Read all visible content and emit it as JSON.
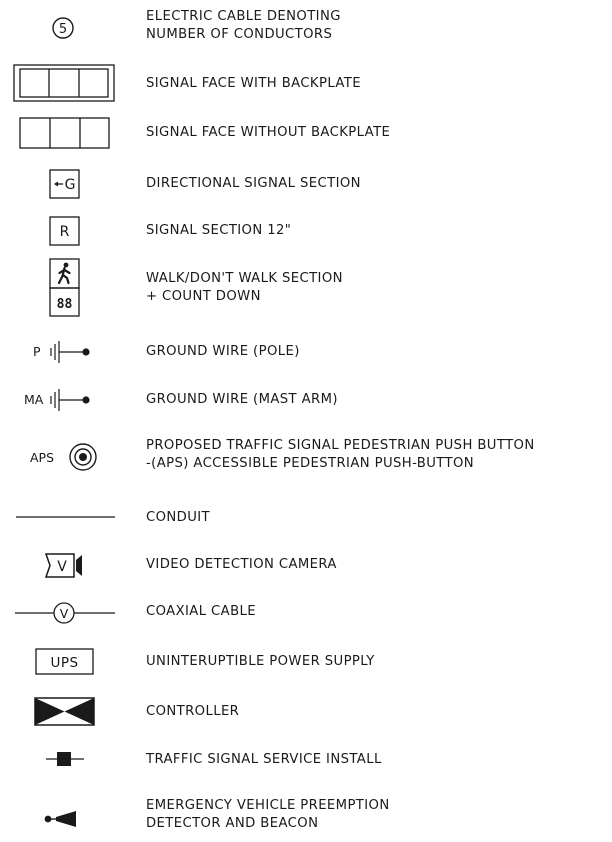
{
  "legend": [
    {
      "symbol": "circle-number",
      "glyph": "5",
      "lines": [
        "ELECTRIC CABLE DENOTING",
        "NUMBER OF CONDUCTORS"
      ]
    },
    {
      "symbol": "signal-face-backplate",
      "lines": [
        "SIGNAL FACE WITH BACKPLATE"
      ]
    },
    {
      "symbol": "signal-face-no-backplate",
      "lines": [
        "SIGNAL FACE WITHOUT BACKPLATE"
      ]
    },
    {
      "symbol": "directional-signal",
      "glyph": "G",
      "lines": [
        "DIRECTIONAL SIGNAL SECTION"
      ]
    },
    {
      "symbol": "signal-section",
      "glyph": "R",
      "lines": [
        "SIGNAL SECTION 12\""
      ]
    },
    {
      "symbol": "walk-dont-walk",
      "glyph": "88",
      "lines": [
        "WALK/DON'T WALK SECTION",
        "+ COUNT DOWN"
      ]
    },
    {
      "symbol": "ground-wire",
      "glyph": "P",
      "lines": [
        "GROUND WIRE (POLE)"
      ]
    },
    {
      "symbol": "ground-wire",
      "glyph": "MA",
      "lines": [
        "GROUND WIRE (MAST ARM)"
      ]
    },
    {
      "symbol": "push-button",
      "glyph": "APS",
      "lines": [
        "PROPOSED TRAFFIC SIGNAL PEDESTRIAN PUSH BUTTON",
        "-(APS) ACCESSIBLE PEDESTRIAN PUSH-BUTTON"
      ]
    },
    {
      "symbol": "conduit",
      "lines": [
        "CONDUIT"
      ]
    },
    {
      "symbol": "video-camera",
      "glyph": "V",
      "lines": [
        "VIDEO DETECTION CAMERA"
      ]
    },
    {
      "symbol": "coaxial-cable",
      "glyph": "V",
      "lines": [
        "COAXIAL CABLE"
      ]
    },
    {
      "symbol": "ups-box",
      "glyph": "UPS",
      "lines": [
        "UNINTERUPTIBLE POWER SUPPLY"
      ]
    },
    {
      "symbol": "controller",
      "lines": [
        "CONTROLLER"
      ]
    },
    {
      "symbol": "service-install",
      "lines": [
        "TRAFFIC SIGNAL SERVICE INSTALL"
      ]
    },
    {
      "symbol": "preemption-detector",
      "lines": [
        "EMERGENCY VEHICLE PREEMPTION",
        "DETECTOR AND BEACON"
      ]
    }
  ],
  "colors": {
    "ink": "#1a1a1a",
    "background": "#ffffff"
  }
}
